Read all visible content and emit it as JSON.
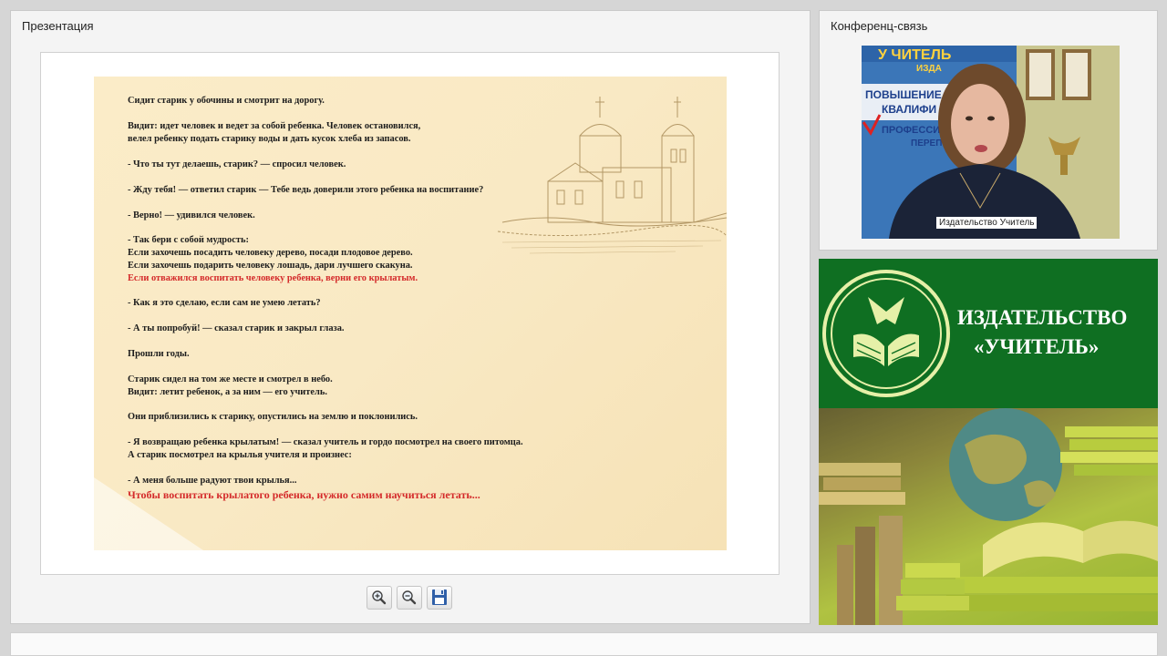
{
  "presentation": {
    "title": "Презентация",
    "slide_lines": [
      "Сидит старик у обочины и смотрит на дорогу.",
      "Видит: идет человек и ведет за собой ребенка. Человек остановился,",
      "велел ребенку подать старику воды и дать кусок хлеба из запасов.",
      "- Что ты тут делаешь, старик? — спросил человек.",
      "- Жду тебя! — ответил старик — Тебе ведь доверили этого ребенка на воспитание?",
      "- Верно! — удивился человек.",
      "- Так бери с собой мудрость:",
      "Если захочешь посадить человеку дерево, посади плодовое дерево.",
      "Если захочешь подарить человеку лошадь, дари лучшего скакуна.",
      "Если отважился воспитать человеку ребенка, верни его крылатым.",
      "- Как я это сделаю, если сам не умею летать?",
      "- А ты попробуй! — сказал старик и закрыл глаза.",
      "Прошли годы.",
      "Старик сидел на том же месте и смотрел в небо.",
      "Видит: летит ребенок, а за ним — его учитель.",
      "Они приблизились к старику, опустились на землю и поклонились.",
      "- Я возвращаю ребенка крылатым! — сказал учитель и гордо посмотрел на своего питомца.",
      "А старик посмотрел на крылья учителя и произнес:",
      "- А меня больше радуют твои крылья...",
      "Чтобы воспитать крылатого ребенка, нужно самим научиться летать..."
    ],
    "toolbar": {
      "zoom_in_icon": "magnifier-plus-icon",
      "zoom_out_icon": "magnifier-minus-icon",
      "save_icon": "floppy-disk-icon"
    }
  },
  "conference": {
    "title": "Конференц-связь",
    "participant_name": "Издательство Учитель",
    "backdrop_text": [
      "У ЧИТЕЛЬ",
      "ИЗДА",
      "ПОВЫШЕНИЕ",
      "КВАЛИФИ",
      "ПРОФЕССИ",
      "ПЕРЕП"
    ]
  },
  "banner": {
    "title_line1": "ИЗДАТЕЛЬСТВО",
    "title_line2": "«УЧИТЕЛЬ»"
  },
  "colors": {
    "accent_green": "#0f6f22",
    "slide_red": "#d42a2a",
    "slide_bg": "#f9e9c4"
  }
}
